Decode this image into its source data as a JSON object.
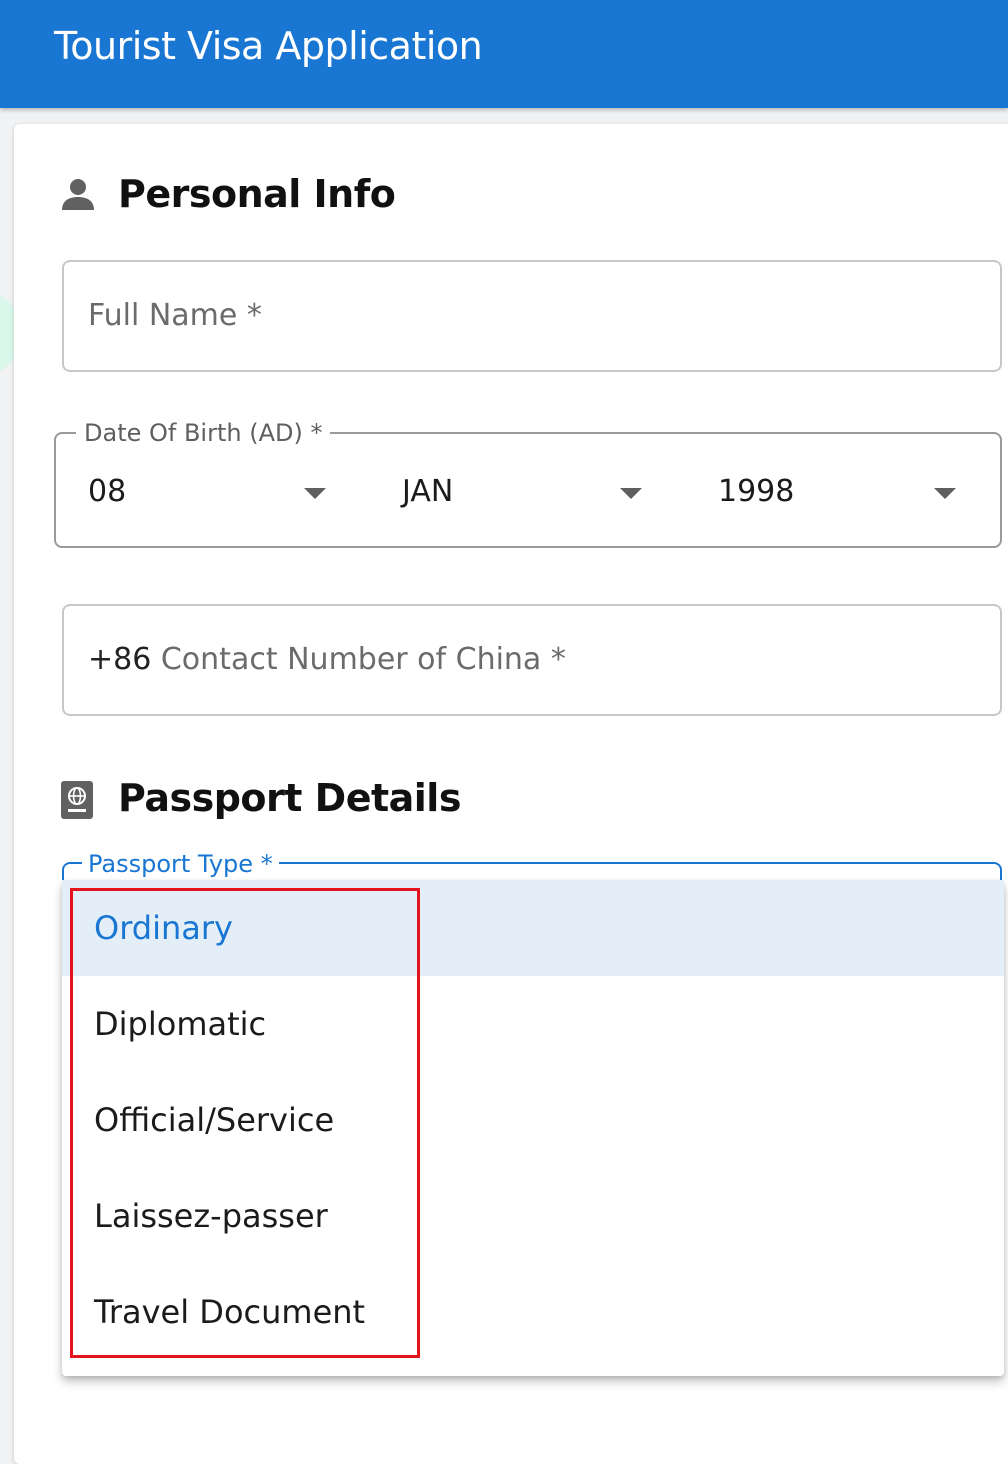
{
  "appbar": {
    "title": "Tourist Visa Application"
  },
  "personal_info": {
    "heading": "Personal Info",
    "icon": "person-icon",
    "full_name": {
      "placeholder": "Full Name *",
      "value": ""
    },
    "dob": {
      "legend": "Date Of Birth (AD) *",
      "day": "08",
      "month": "JAN",
      "year": "1998"
    },
    "contact": {
      "prefix": "+86",
      "placeholder": "Contact Number of China *",
      "value": ""
    }
  },
  "passport_details": {
    "heading": "Passport Details",
    "icon": "passport-icon",
    "passport_type": {
      "legend": "Passport Type *",
      "options": [
        "Ordinary",
        "Diplomatic",
        "Official/Service",
        "Laissez-passer",
        "Travel Document"
      ],
      "highlighted": "Ordinary"
    }
  },
  "colors": {
    "appbar": "#1976d2",
    "accent": "#1976d2",
    "selected_bg": "#e3eef9",
    "highlight_box": "#e3141c"
  }
}
